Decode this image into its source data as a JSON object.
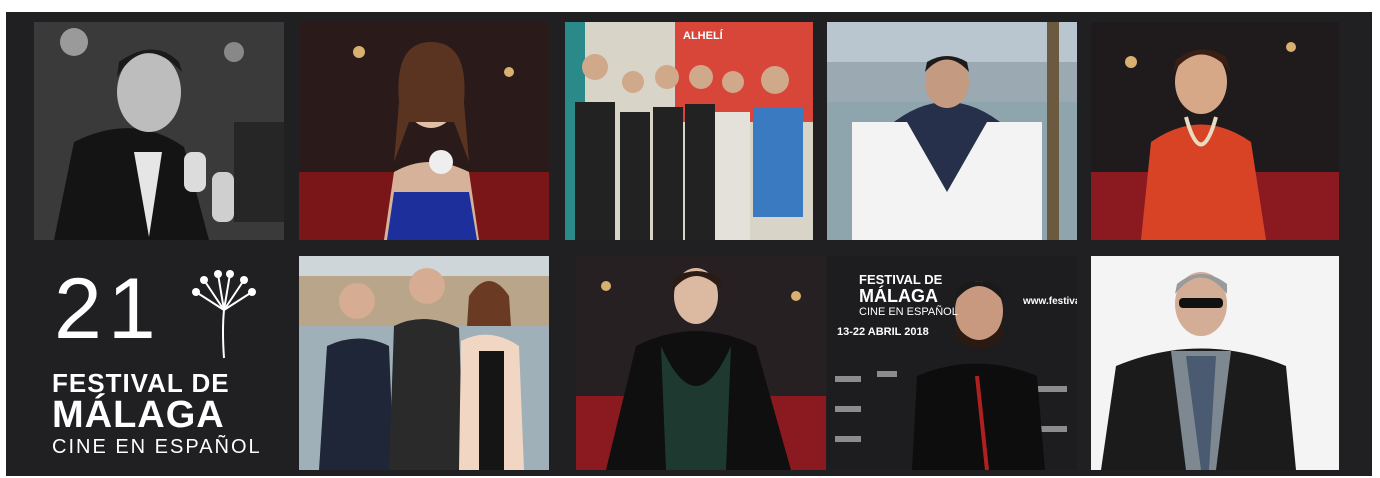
{
  "logo": {
    "number": "21",
    "line1": "FESTIVAL DE",
    "line2": "MÁLAGA",
    "line3": "CINE EN ESPAÑOL"
  },
  "tiles": {
    "t3": {
      "banner": "ALHELÍ"
    },
    "t9": {
      "line1": "FESTIVAL DE",
      "line2": "MÁLAGA",
      "line3": "CINE EN ESPAÑOL",
      "dates": "13-22 ABRIL 2018",
      "url": "www.festiva"
    }
  },
  "colors": {
    "frame": "#202023",
    "red_carpet": "#b0202a"
  }
}
